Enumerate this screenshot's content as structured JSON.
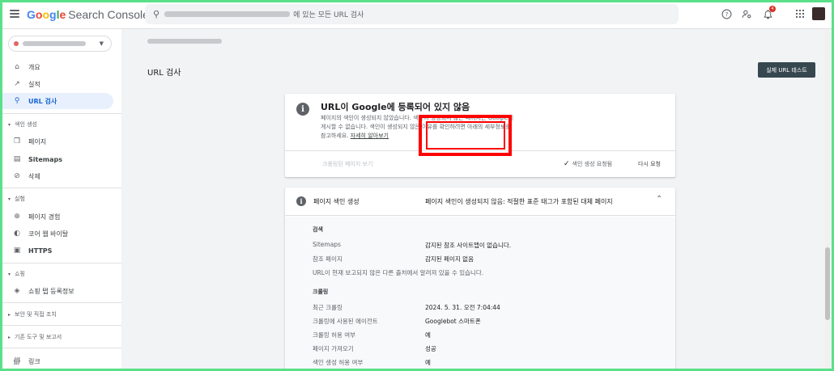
{
  "header": {
    "logo_google": "Google",
    "logo_product": "Search Console",
    "search_placeholder": "에 있는 모든 URL 검사",
    "notification_count": "4"
  },
  "sidebar": {
    "items": [
      {
        "label": "개요",
        "icon": "home-icon"
      },
      {
        "label": "실적",
        "icon": "trending-icon"
      },
      {
        "label": "URL 검사",
        "icon": "search-icon"
      }
    ],
    "sections": [
      {
        "title": "색인 생성",
        "items": [
          {
            "label": "페이지",
            "icon": "pages-icon"
          },
          {
            "label": "Sitemaps",
            "icon": "sitemap-icon"
          },
          {
            "label": "삭제",
            "icon": "removal-icon"
          }
        ]
      },
      {
        "title": "실험",
        "items": [
          {
            "label": "페이지 경험",
            "icon": "plus-circle-icon"
          },
          {
            "label": "코어 웹 바이탈",
            "icon": "gauge-icon"
          },
          {
            "label": "HTTPS",
            "icon": "lock-icon"
          }
        ]
      },
      {
        "title": "쇼핑",
        "items": [
          {
            "label": "쇼핑 탭 등록정보",
            "icon": "tag-icon"
          }
        ]
      },
      {
        "title": "보안 및 직접 조치",
        "items": []
      },
      {
        "title": "기존 도구 및 보고서",
        "items": []
      }
    ],
    "bottom_item": {
      "label": "링크",
      "icon": "links-icon"
    }
  },
  "main": {
    "page_title": "URL 검사",
    "test_button": "실제 URL 테스트",
    "status_card": {
      "title": "URL이 Google에 등록되어 있지 않음",
      "desc_line1": "페이지의 색인이 생성되지 않았습니다. 색인이 생성되지 않은 페이지는 Google에",
      "desc_line2": "게시할 수 없습니다. 색인이 생성되지 않은 이유를 확인하려면 아래의 세부정보를",
      "desc_line3": "참고하세요.",
      "desc_link": "자세히 알아보기",
      "crawled_link": "크롤링된 페이지 보기",
      "requested": "색인 생성 요청됨",
      "retry": "다시 요청"
    },
    "index_card": {
      "label": "페이지 색인 생성",
      "status": "페이지 색인이 생성되지 않음: 적절한 표준 태그가 포함된 대체 페이지",
      "discovery_head": "검색",
      "sitemaps_label": "Sitemaps",
      "sitemaps_value": "감지된 참조 사이트맵이 없습니다.",
      "ref_label": "참조 페이지",
      "ref_value": "감지된 페이지 없음",
      "note": "URL이 현재 보고되지 않은 다른 출처에서 알려져 있을 수 있습니다.",
      "crawl_head": "크롤링",
      "last_crawl_label": "최근 크롤링",
      "last_crawl_value": "2024. 5. 31. 오전 7:04:44",
      "agent_label": "크롤링에 사용된 에이전트",
      "agent_value": "Googlebot 스마트폰",
      "allowed_label": "크롤링 허용 여부",
      "allowed_value": "예",
      "fetch_label": "페이지 가져오기",
      "fetch_value": "성공",
      "index_allowed_label": "색인 생성 허용 여부",
      "index_allowed_value": "예"
    }
  }
}
